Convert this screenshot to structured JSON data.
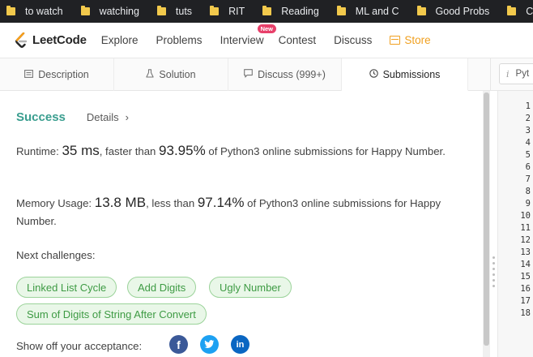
{
  "bookmarks": [
    {
      "label": "to watch"
    },
    {
      "label": "watching"
    },
    {
      "label": "tuts"
    },
    {
      "label": "RIT"
    },
    {
      "label": "Reading"
    },
    {
      "label": "ML and C"
    },
    {
      "label": "Good Probs"
    },
    {
      "label": "Current"
    }
  ],
  "navbar": {
    "logo_text": "LeetCode",
    "items": [
      {
        "label": "Explore"
      },
      {
        "label": "Problems"
      },
      {
        "label": "Interview",
        "badge": "New"
      },
      {
        "label": "Contest"
      },
      {
        "label": "Discuss"
      },
      {
        "label": "Store"
      }
    ]
  },
  "tabs": [
    {
      "label": "Description",
      "icon": "document-icon"
    },
    {
      "label": "Solution",
      "icon": "flask-icon"
    },
    {
      "label": "Discuss (999+)",
      "icon": "chat-icon"
    },
    {
      "label": "Submissions",
      "icon": "clock-icon",
      "active": true
    }
  ],
  "language_selector": {
    "icon": "i",
    "value": "Pyt"
  },
  "result": {
    "status": "Success",
    "details_link": "Details",
    "details_chevron": "›",
    "runtime_label": "Runtime: ",
    "runtime_value": "35 ms",
    "runtime_mid": ", faster than ",
    "runtime_percent": "93.95%",
    "runtime_tail": " of Python3 online submissions for Happy Number.",
    "memory_label": "Memory Usage: ",
    "memory_value": "13.8 MB",
    "memory_mid": ", less than ",
    "memory_percent": "97.14%",
    "memory_tail": " of Python3 online submissions for Happy Number."
  },
  "next_challenges": {
    "label": "Next challenges:",
    "items": [
      {
        "label": "Linked List Cycle"
      },
      {
        "label": "Add Digits"
      },
      {
        "label": "Ugly Number"
      },
      {
        "label": "Sum of Digits of String After Convert"
      }
    ]
  },
  "share": {
    "label": "Show off your acceptance:",
    "facebook": "f",
    "twitter": "t",
    "linkedin": "in"
  },
  "colors": {
    "success": "#3a9e8f",
    "chip_border": "#9bd39a",
    "chip_text": "#3e9b44",
    "store": "#f0a020",
    "facebook": "#3b5998",
    "twitter": "#1da1f2",
    "linkedin": "#0a66c2"
  },
  "editor": {
    "line_numbers": [
      "1",
      "2",
      "3",
      "4",
      "5",
      "6",
      "7",
      "8",
      "9",
      "10",
      "11",
      "12",
      "13",
      "14",
      "15",
      "16",
      "17",
      "18"
    ]
  }
}
